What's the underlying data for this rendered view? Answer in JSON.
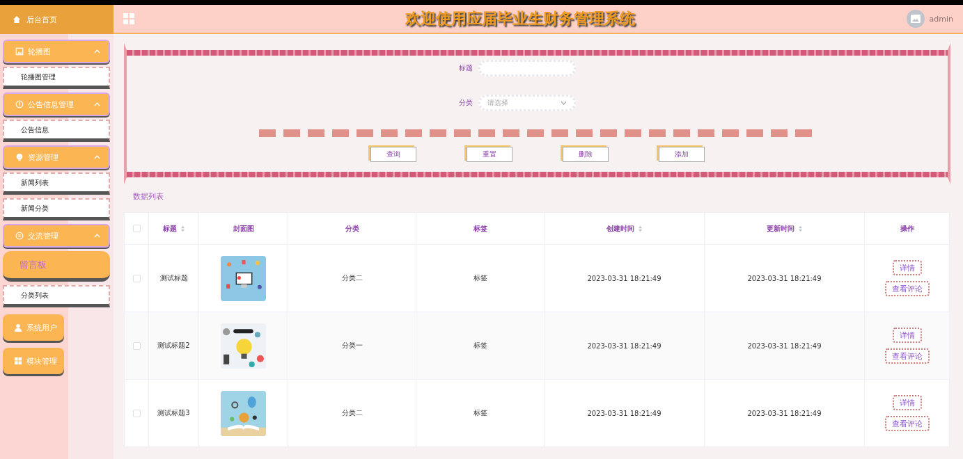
{
  "header": {
    "home": "后台首页",
    "title": "欢迎使用应届毕业生财务管理系统",
    "user": "admin"
  },
  "sidebar": {
    "items": [
      {
        "kind": "group",
        "label": "轮播图",
        "expanded": true,
        "children": [
          {
            "label": "轮播图管理",
            "selected": false
          }
        ]
      },
      {
        "kind": "group",
        "label": "公告信息管理",
        "expanded": true,
        "children": [
          {
            "label": "公告信息",
            "selected": false
          }
        ]
      },
      {
        "kind": "group",
        "label": "资源管理",
        "expanded": true,
        "children": [
          {
            "label": "新闻列表",
            "selected": false
          },
          {
            "label": "新闻分类",
            "selected": false
          }
        ]
      },
      {
        "kind": "group",
        "label": "交流管理",
        "expanded": true,
        "children": [
          {
            "label": "留言板",
            "selected": true
          },
          {
            "label": "分类列表",
            "selected": false
          }
        ]
      },
      {
        "kind": "link",
        "label": "系统用户"
      },
      {
        "kind": "link",
        "label": "模块管理"
      }
    ]
  },
  "search": {
    "fields": [
      {
        "kind": "input",
        "label": "标题"
      },
      {
        "kind": "select",
        "label": "分类",
        "placeholder": "请选择"
      }
    ],
    "buttons": [
      "查询",
      "重置",
      "删除",
      "添加"
    ]
  },
  "section_title": "数据列表",
  "table": {
    "select_all_checked": false,
    "columns": [
      {
        "label": "标题",
        "sortable": true
      },
      {
        "label": "封面图",
        "sortable": false
      },
      {
        "label": "分类",
        "sortable": false
      },
      {
        "label": "标签",
        "sortable": false
      },
      {
        "label": "创建时间",
        "sortable": true
      },
      {
        "label": "更新时间",
        "sortable": true
      },
      {
        "label": "操作",
        "sortable": false
      }
    ],
    "rows": [
      {
        "checked": false,
        "title": "测试标题",
        "cover": {
          "kind": "picture"
        },
        "category": "分类二",
        "tag": "标签",
        "created": "2023-03-31 18:21:49",
        "updated": "2023-03-31 18:21:49",
        "actions": [
          "详情",
          "查看评论"
        ]
      },
      {
        "checked": false,
        "title": "测试标题2",
        "cover": {
          "kind": "picture"
        },
        "category": "分类一",
        "tag": "标签",
        "created": "2023-03-31 18:21:49",
        "updated": "2023-03-31 18:21:49",
        "actions": [
          "详情",
          "查看评论"
        ]
      },
      {
        "checked": false,
        "title": "测试标题3",
        "cover": {
          "kind": "picture"
        },
        "category": "分类二",
        "tag": "标签",
        "created": "2023-03-31 18:21:49",
        "updated": "2023-03-31 18:21:49",
        "actions": [
          "详情",
          "查看评论"
        ]
      }
    ]
  }
}
